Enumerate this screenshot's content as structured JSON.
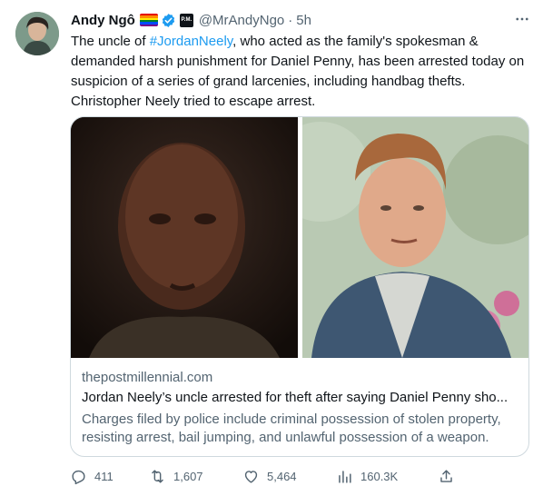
{
  "author": {
    "display_name": "Andy Ngô",
    "handle": "@MrAndyNgo",
    "separator": "·",
    "time": "5h",
    "affiliate_badge": "P.M.",
    "avatar_icon": "avatar"
  },
  "tweet": {
    "text_before": "The uncle of ",
    "hashtag": "#JordanNeely",
    "text_after": ", who acted as the family's spokesman & demanded harsh punishment for Daniel Penny, has been arrested today on suspicion of a series of grand larcenies, including handbag thefts. Christopher Neely tried to escape arrest."
  },
  "card": {
    "domain": "thepostmillennial.com",
    "title": "Jordan Neely’s uncle arrested for theft after saying Daniel Penny sho...",
    "description": "Charges filed by police include criminal possession of stolen property, resisting arrest, bail jumping, and unlawful possession of a weapon."
  },
  "actions": {
    "replies": "411",
    "reposts": "1,607",
    "likes": "5,464",
    "views": "160.3K"
  },
  "colors": {
    "accent": "#1d9bf0",
    "secondary_text": "#536471",
    "border": "#cfd9de"
  }
}
